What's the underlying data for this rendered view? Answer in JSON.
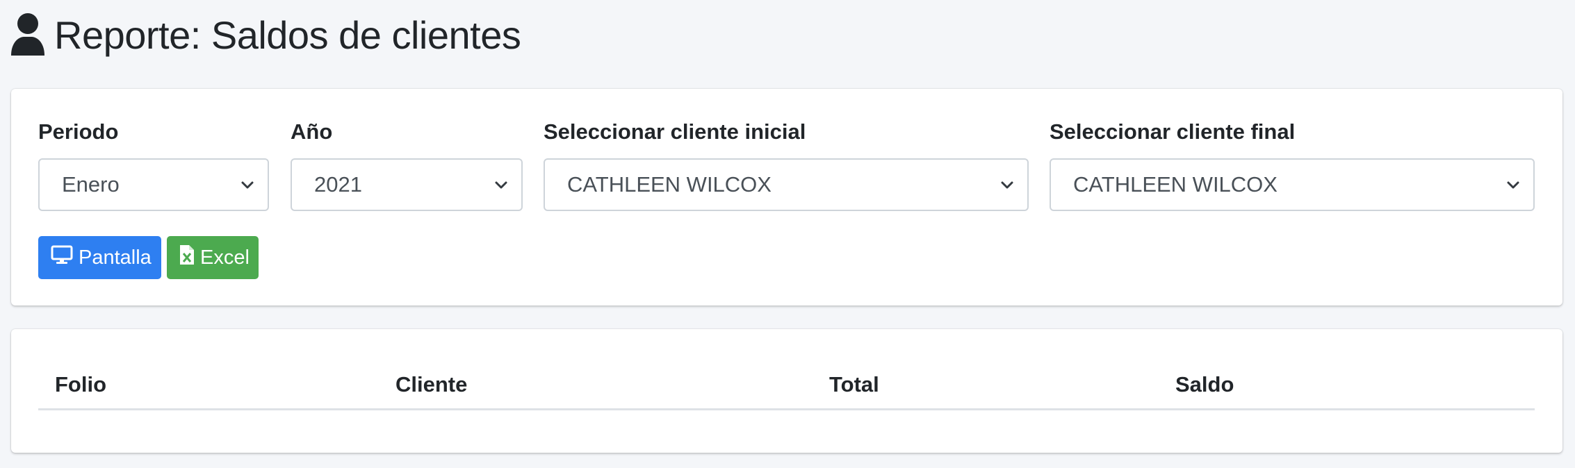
{
  "page": {
    "title": "Reporte: Saldos de clientes",
    "icon": "user-icon"
  },
  "filters": {
    "periodo": {
      "label": "Periodo",
      "value": "Enero"
    },
    "anio": {
      "label": "Año",
      "value": "2021"
    },
    "cliente_inicial": {
      "label": "Seleccionar cliente inicial",
      "value": "CATHLEEN WILCOX"
    },
    "cliente_final": {
      "label": "Seleccionar cliente final",
      "value": "CATHLEEN WILCOX"
    }
  },
  "buttons": {
    "pantalla": {
      "label": "Pantalla",
      "icon": "desktop-icon",
      "color": "#2e7ff1"
    },
    "excel": {
      "label": "Excel",
      "icon": "file-excel-icon",
      "color": "#4caa4f"
    }
  },
  "table": {
    "columns": [
      "Folio",
      "Cliente",
      "Total",
      "Saldo"
    ],
    "rows": []
  }
}
